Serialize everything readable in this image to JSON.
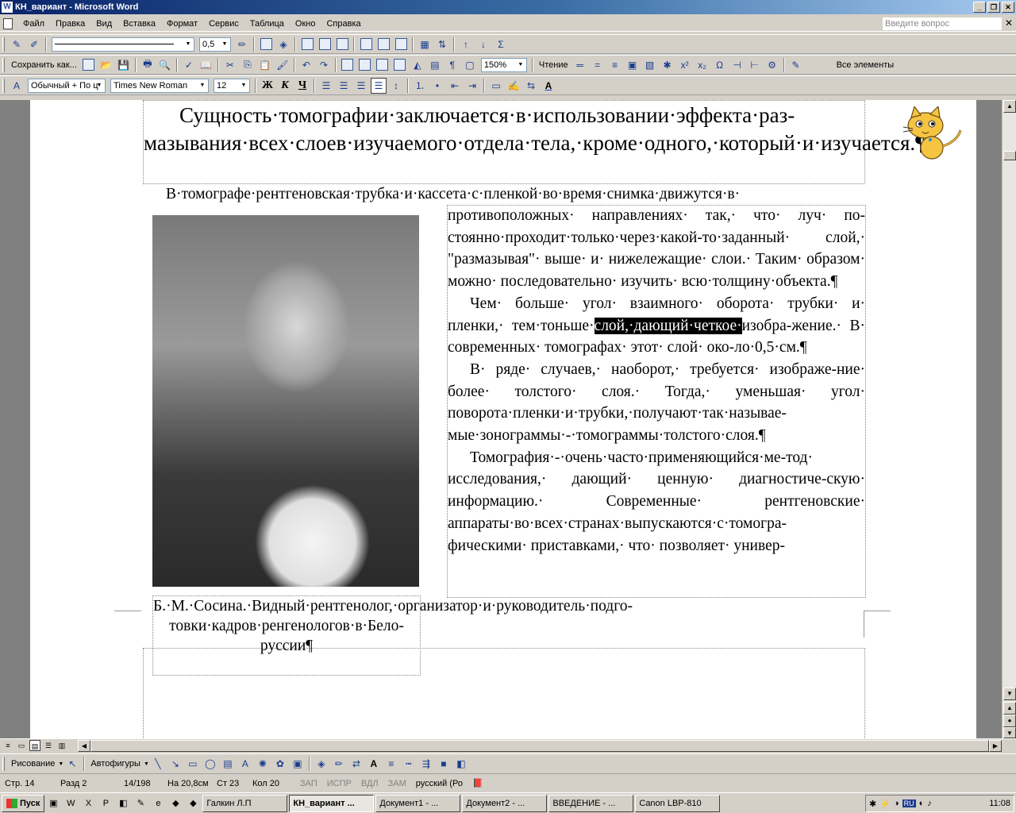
{
  "window": {
    "title": "КН_вариант - Microsoft Word",
    "buttons": {
      "minimize": "_",
      "maximize": "❐",
      "close": "✕"
    }
  },
  "menu": {
    "items": [
      "Файл",
      "Правка",
      "Вид",
      "Вставка",
      "Формат",
      "Сервис",
      "Таблица",
      "Окно",
      "Справка"
    ],
    "ask_placeholder": "Введите вопрос",
    "close": "✕"
  },
  "toolbar1": {
    "line_weight": "0,5",
    "sigma": "Σ"
  },
  "toolbar2": {
    "save_as": "Сохранить как...",
    "zoom": "150%",
    "read": "Чтение",
    "all_elements": "Все элементы",
    "omega": "Ω"
  },
  "toolbar3": {
    "style": "Обычный + По ц",
    "font": "Times New Roman",
    "size": "12",
    "bold": "Ж",
    "italic": "К",
    "underline": "Ч"
  },
  "document": {
    "para1": "Сущность·томографии·заключается·в·использовании·эффекта·раз-мазывания·всех·слоев·изучаемого·отдела·тела,·кроме·одного,·который·и·изучается.¶",
    "para2": "В·томографе·рентгеновская·трубка·и·кассета·с·пленкой·во·время·снимка·движутся·в·",
    "col_p1": "противоположных· направлениях· так,· что· луч· по-стоянно·проходит·только·через·какой-то·заданный· слой,· \"размазывая\"· выше· и· нижележащие· слои.· Таким· образом· можно· последовательно· изучить· всю·толщину·объекта.¶",
    "col_p2_before": "Чем· больше· угол· взаимного· оборота· трубки· и· пленки,· тем·тоньше·",
    "col_p2_highlight": "слой,·дающий·четкое·",
    "col_p2_after": "изобра-жение.· В· современных· томографах· этот· слой· око-ло·0,5·см.¶",
    "col_p3": "В· ряде· случаев,· наоборот,· требуется· изображе-ние· более· толстого· слоя.· Тогда,· уменьшая· угол· поворота·пленки·и·трубки,·получают·так·называе-мые·зонограммы·-·томограммы·толстого·слоя.¶",
    "col_p4": "Томография·-·очень·часто·применяющийся·ме-тод· исследования,· дающий· ценную· диагностиче-скую· информацию.· Современные· рентгеновские· аппараты·во·всех·странах·выпускаются·с·томогра-фическими· приставками,· что· позволяет· универ-",
    "caption": "Б.·М.·Сосина.·Видный·рентгенолог,·организатор·и·руководитель·подго-товки·кадров·ренгенологов·в·Бело-руссии¶"
  },
  "drawbar": {
    "draw": "Рисование",
    "autoshapes": "Автофигуры"
  },
  "status": {
    "page": "Стр. 14",
    "section": "Разд 2",
    "pages": "14/198",
    "at": "На 20,8см",
    "line": "Ст 23",
    "col": "Кол 20",
    "rec": "ЗАП",
    "trk": "ИСПР",
    "ext": "ВДЛ",
    "ovr": "ЗАМ",
    "lang": "русский (Ро"
  },
  "taskbar": {
    "start": "Пуск",
    "tasks": [
      "Галкин Л.П",
      "КН_вариант ...",
      "Документ1 - ...",
      "Документ2 - ...",
      "ВВЕДЕНИЕ - ...",
      "Canon LBP-810"
    ],
    "lang": "RU",
    "clock": "11:08"
  }
}
